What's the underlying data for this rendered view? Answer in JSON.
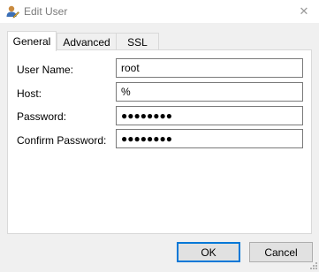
{
  "window": {
    "title": "Edit User",
    "icon": "user-edit-icon",
    "close_glyph": "✕"
  },
  "tabs": [
    {
      "label": "General",
      "active": true
    },
    {
      "label": "Advanced",
      "active": false
    },
    {
      "label": "SSL",
      "active": false
    }
  ],
  "form": {
    "user_name": {
      "label": "User Name:",
      "value": "root"
    },
    "host": {
      "label": "Host:",
      "value": "%"
    },
    "password": {
      "label": "Password:",
      "value": "●●●●●●●●"
    },
    "confirm_password": {
      "label": "Confirm Password:",
      "value": "●●●●●●●●"
    }
  },
  "buttons": {
    "ok_label": "OK",
    "cancel_label": "Cancel"
  },
  "colors": {
    "accent": "#0078d7",
    "window_bg": "#f0f0f0",
    "panel_bg": "#ffffff"
  }
}
